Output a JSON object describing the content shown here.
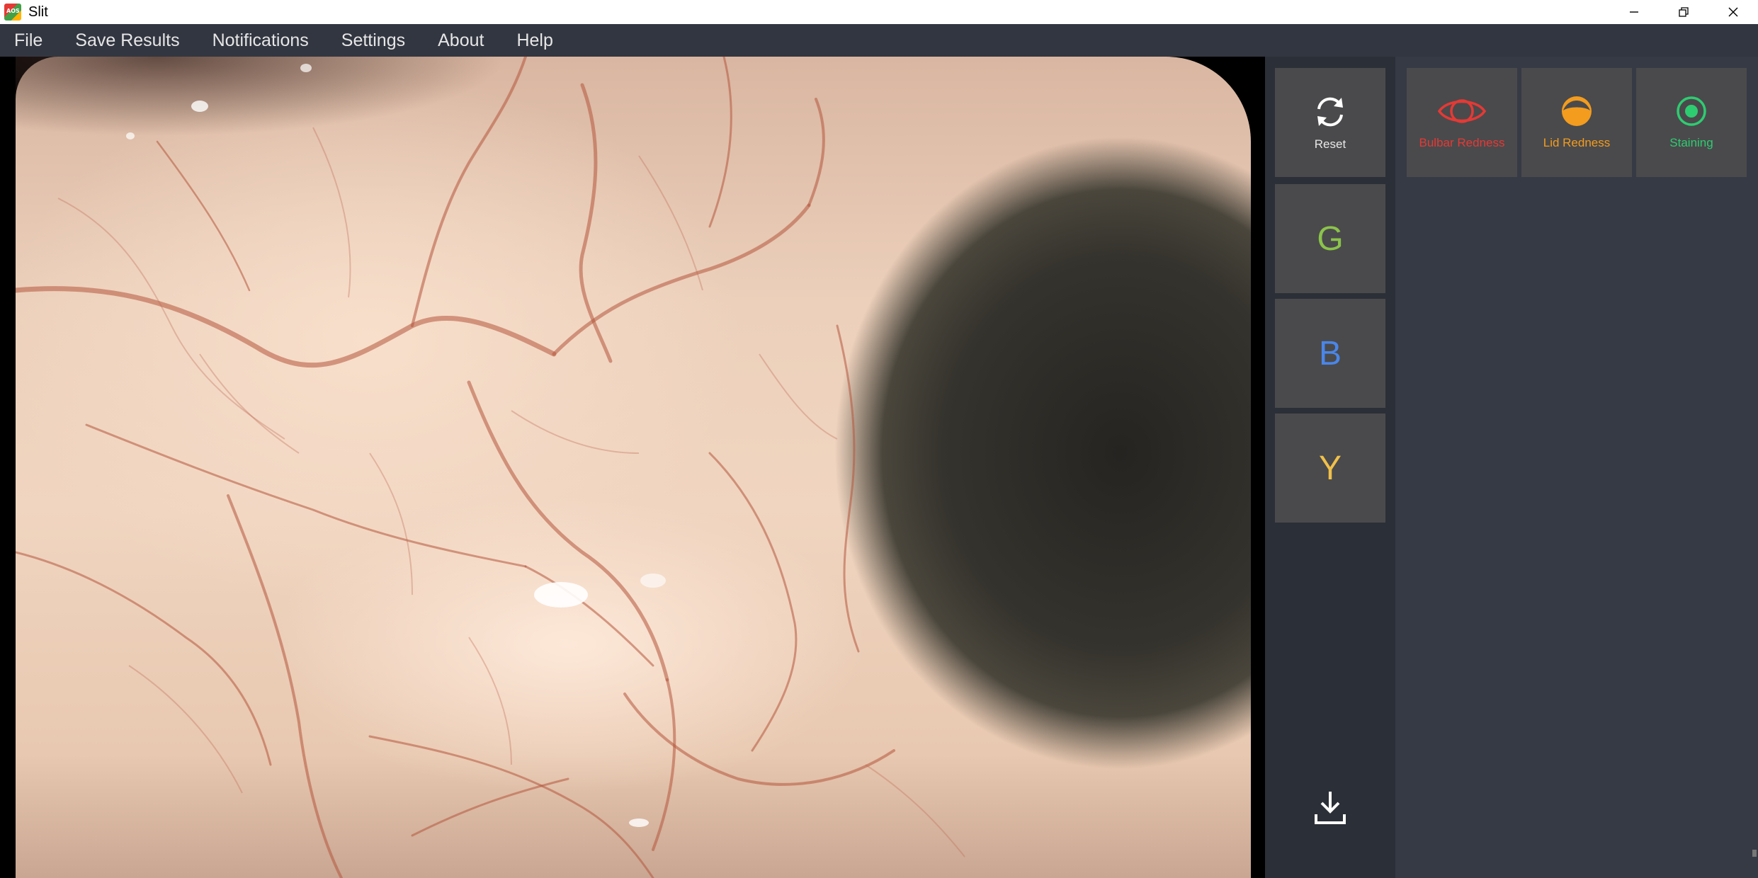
{
  "window": {
    "title": "Slit",
    "app_icon_text": "AOS",
    "controls": [
      "minimize-icon",
      "restore-icon",
      "close-icon"
    ]
  },
  "menu": {
    "items": [
      "File",
      "Save Results",
      "Notifications",
      "Settings",
      "About",
      "Help"
    ]
  },
  "tools": {
    "reset_label": "Reset",
    "reset_icon": "refresh-icon",
    "g_label": "G",
    "b_label": "B",
    "y_label": "Y",
    "download_icon": "download-icon",
    "colors": {
      "g": "#8bc34a",
      "b": "#4a86e8",
      "y": "#f0c04a"
    }
  },
  "modes": {
    "bulbar": {
      "label": "Bulbar Redness",
      "icon": "eye-icon",
      "color": "#e53935"
    },
    "lid": {
      "label": "Lid Redness",
      "icon": "half-circle-icon",
      "color": "#f39c1e"
    },
    "staining": {
      "label": "Staining",
      "icon": "target-icon",
      "color": "#2ecc71"
    }
  },
  "image": {
    "subject": "slit-lamp-eye-photo"
  }
}
